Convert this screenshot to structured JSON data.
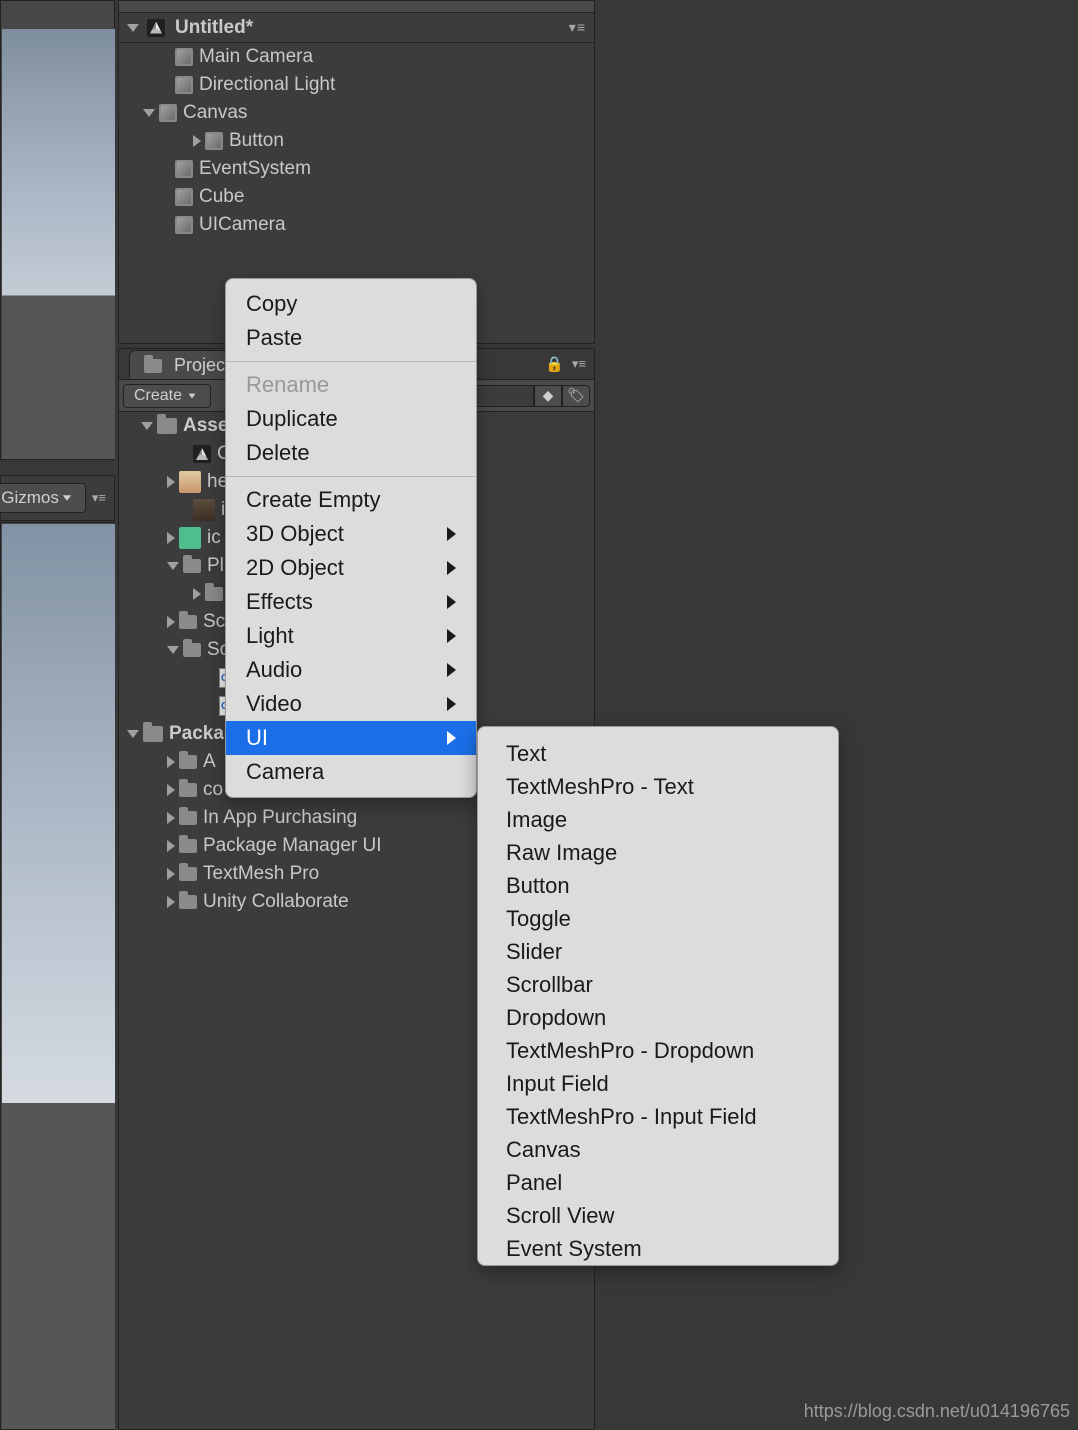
{
  "viewport": {
    "gizmos_label": "Gizmos"
  },
  "hierarchy": {
    "scene_name": "Untitled*",
    "items": {
      "main_camera": "Main Camera",
      "directional_light": "Directional Light",
      "canvas": "Canvas",
      "button": "Button",
      "event_system": "EventSystem",
      "cube": "Cube",
      "ui_camera": "UICamera"
    }
  },
  "project": {
    "tab_label": "Project",
    "create_label": "Create",
    "assets_label": "Assets",
    "packages_label": "Packages",
    "assets": {
      "c_partial": "C",
      "he_partial": "he",
      "ic_partial1": "ic",
      "ic_partial2": "ic",
      "pl_partial": "Pl",
      "sc_partial1": "Sc",
      "sc_partial2": "Sc"
    },
    "packages": {
      "a_partial": "A",
      "co_partial": "co",
      "in_app_purchasing": "In App Purchasing",
      "package_manager_ui": "Package Manager UI",
      "textmesh_pro": "TextMesh Pro",
      "unity_collaborate": "Unity Collaborate"
    }
  },
  "context_menu": {
    "copy": "Copy",
    "paste": "Paste",
    "rename": "Rename",
    "duplicate": "Duplicate",
    "delete": "Delete",
    "create_empty": "Create Empty",
    "three_d_object": "3D Object",
    "two_d_object": "2D Object",
    "effects": "Effects",
    "light": "Light",
    "audio": "Audio",
    "video": "Video",
    "ui": "UI",
    "camera": "Camera"
  },
  "ui_submenu": {
    "items": [
      "Text",
      "TextMeshPro - Text",
      "Image",
      "Raw Image",
      "Button",
      "Toggle",
      "Slider",
      "Scrollbar",
      "Dropdown",
      "TextMeshPro - Dropdown",
      "Input Field",
      "TextMeshPro - Input Field",
      "Canvas",
      "Panel",
      "Scroll View",
      "Event System"
    ]
  },
  "footer": {
    "url": "https://blog.csdn.net/u014196765"
  }
}
